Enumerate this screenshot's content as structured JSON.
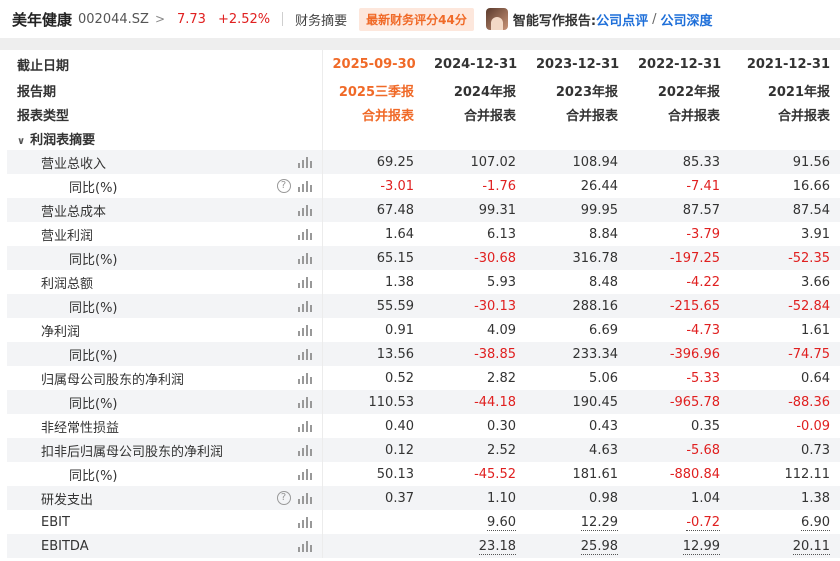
{
  "header": {
    "stock_name": "美年健康",
    "stock_code": "002044.SZ",
    "chevron": ">",
    "price": "7.73",
    "change_pct": "+2.52%",
    "tab_label": "财务摘要",
    "score_badge": "最新财务评分44分",
    "ai_report_label": "智能写作报告:",
    "link_review": "公司点评",
    "link_sep": "/",
    "link_depth": "公司深度"
  },
  "colors": {
    "up_red": "#e02020",
    "accent_orange": "#f06a28",
    "link_blue": "#1e6fd9"
  },
  "table": {
    "header_rows": [
      {
        "label": "截止日期",
        "values": [
          "2025-09-30",
          "2024-12-31",
          "2023-12-31",
          "2022-12-31",
          "2021-12-31"
        ]
      },
      {
        "label": "报告期",
        "values": [
          "2025三季报",
          "2024年报",
          "2023年报",
          "2022年报",
          "2021年报"
        ]
      },
      {
        "label": "报表类型",
        "values": [
          "合并报表",
          "合并报表",
          "合并报表",
          "合并报表",
          "合并报表"
        ]
      }
    ],
    "section_title": "利润表摘要",
    "section_caret": "∨",
    "help_glyph": "?",
    "rows": [
      {
        "label": "营业总收入",
        "values": [
          "69.25",
          "107.02",
          "108.94",
          "85.33",
          "91.56"
        ]
      },
      {
        "label": "同比(%)",
        "values": [
          "-3.01",
          "-1.76",
          "26.44",
          "-7.41",
          "16.66"
        ]
      },
      {
        "label": "营业总成本",
        "values": [
          "67.48",
          "99.31",
          "99.95",
          "87.57",
          "87.54"
        ]
      },
      {
        "label": "营业利润",
        "values": [
          "1.64",
          "6.13",
          "8.84",
          "-3.79",
          "3.91"
        ]
      },
      {
        "label": "同比(%)",
        "values": [
          "65.15",
          "-30.68",
          "316.78",
          "-197.25",
          "-52.35"
        ]
      },
      {
        "label": "利润总额",
        "values": [
          "1.38",
          "5.93",
          "8.48",
          "-4.22",
          "3.66"
        ]
      },
      {
        "label": "同比(%)",
        "values": [
          "55.59",
          "-30.13",
          "288.16",
          "-215.65",
          "-52.84"
        ]
      },
      {
        "label": "净利润",
        "values": [
          "0.91",
          "4.09",
          "6.69",
          "-4.73",
          "1.61"
        ]
      },
      {
        "label": "同比(%)",
        "values": [
          "13.56",
          "-38.85",
          "233.34",
          "-396.96",
          "-74.75"
        ]
      },
      {
        "label": "归属母公司股东的净利润",
        "values": [
          "0.52",
          "2.82",
          "5.06",
          "-5.33",
          "0.64"
        ]
      },
      {
        "label": "同比(%)",
        "values": [
          "110.53",
          "-44.18",
          "190.45",
          "-965.78",
          "-88.36"
        ]
      },
      {
        "label": "非经常性损益",
        "values": [
          "0.40",
          "0.30",
          "0.43",
          "0.35",
          "-0.09"
        ]
      },
      {
        "label": "扣非后归属母公司股东的净利润",
        "values": [
          "0.12",
          "2.52",
          "4.63",
          "-5.68",
          "0.73"
        ]
      },
      {
        "label": "同比(%)",
        "values": [
          "50.13",
          "-45.52",
          "181.61",
          "-880.84",
          "112.11"
        ]
      },
      {
        "label": "研发支出",
        "values": [
          "0.37",
          "1.10",
          "0.98",
          "1.04",
          "1.38"
        ]
      },
      {
        "label": "EBIT",
        "values": [
          "",
          "9.60",
          "12.29",
          "-0.72",
          "6.90"
        ]
      },
      {
        "label": "EBITDA",
        "values": [
          "",
          "23.18",
          "25.98",
          "12.99",
          "20.11"
        ]
      }
    ]
  }
}
